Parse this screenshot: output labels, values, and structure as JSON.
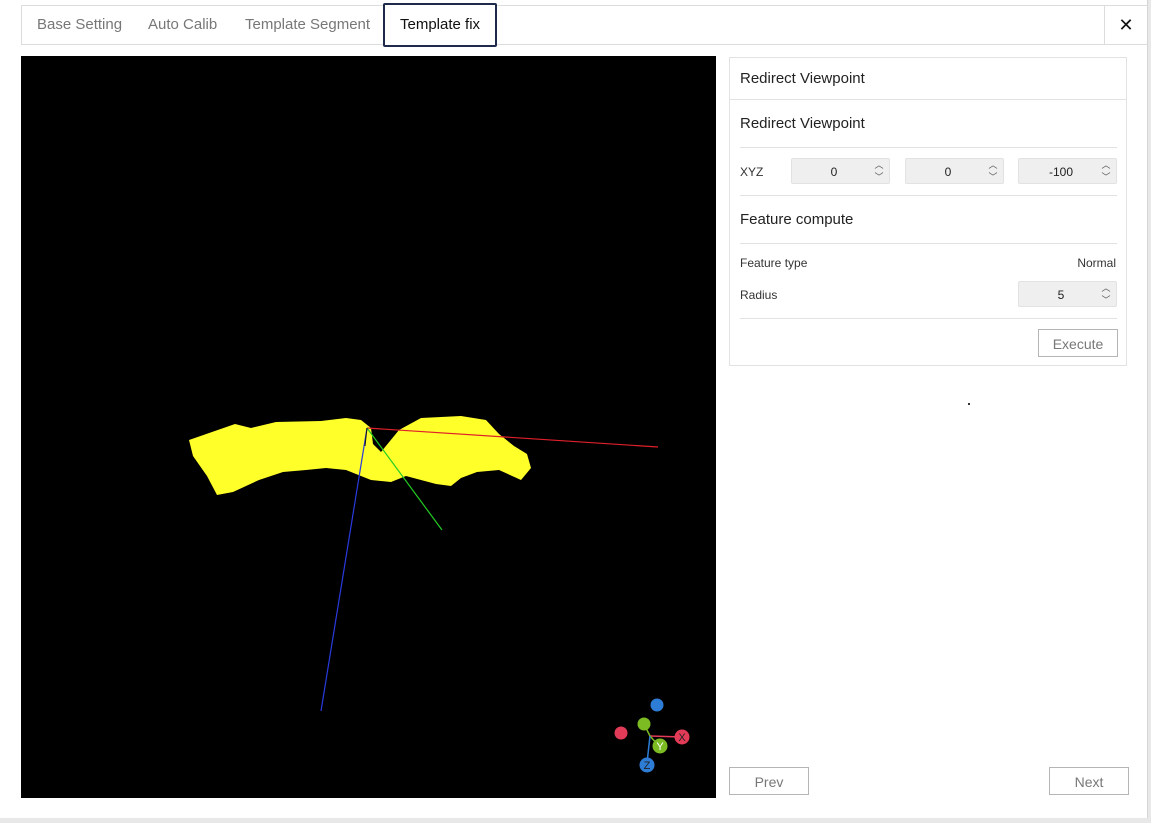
{
  "tabs": [
    {
      "label": "Base Setting"
    },
    {
      "label": "Auto Calib"
    },
    {
      "label": "Template Segment"
    },
    {
      "label": "Template fix"
    }
  ],
  "active_tab": "Template fix",
  "close_icon": "close-icon",
  "panel": {
    "header": "Redirect Viewpoint",
    "redirect_title": "Redirect Viewpoint",
    "xyz_label": "XYZ",
    "xyz_values": [
      "0",
      "0",
      "-100"
    ],
    "feature_title": "Feature compute",
    "feature_type_label": "Feature type",
    "feature_type_value": "Normal",
    "radius_label": "Radius",
    "radius_value": "5",
    "execute_label": "Execute"
  },
  "nav": {
    "prev_label": "Prev",
    "next_label": "Next"
  },
  "gizmo": {
    "x_label": "X",
    "y_label": "Y",
    "z_label": "Z"
  },
  "colors": {
    "point_cloud": "#ffff2a",
    "axis_x": "#e0202a",
    "axis_y": "#22cc22",
    "axis_z": "#2a3adf",
    "gizmo_x": "#e23b57",
    "gizmo_y": "#7dbb22",
    "gizmo_z": "#2d7dd6",
    "active_tab_border": "#1f2a4a"
  }
}
